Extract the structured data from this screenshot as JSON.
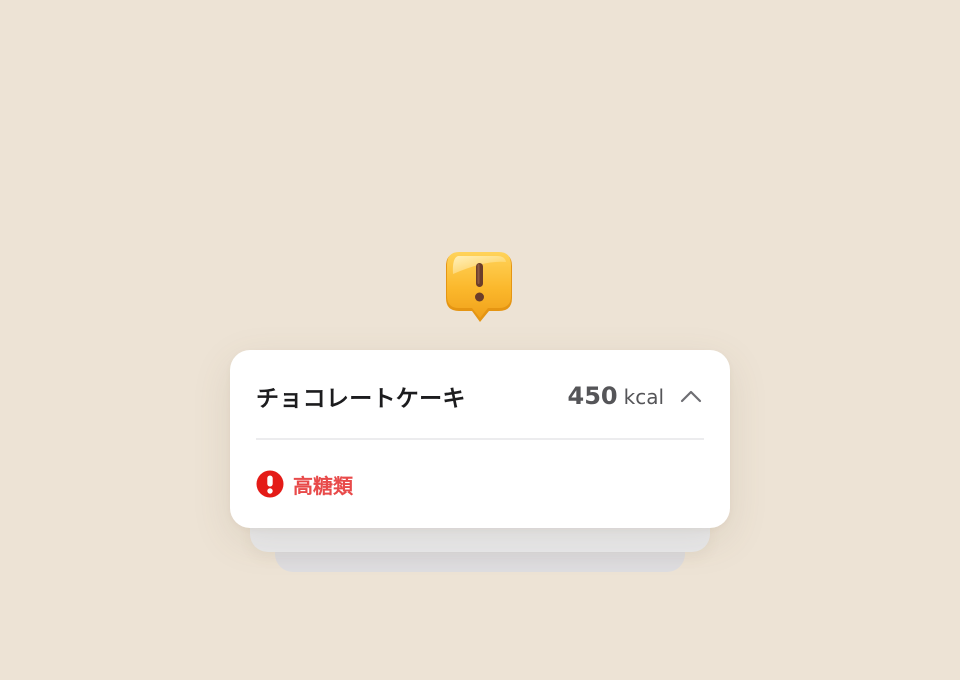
{
  "card": {
    "food_name": "チョコレートケーキ",
    "calorie_value": "450",
    "calorie_unit": "kcal",
    "expanded": true,
    "warnings": [
      {
        "label": "高糖類",
        "icon": "exclamation-circle-icon"
      }
    ]
  },
  "icons": {
    "badge": "alert-speech-bubble-icon",
    "toggle": "chevron-up-icon"
  },
  "colors": {
    "background": "#ede3d5",
    "warning": "#e84a4a",
    "badge": "#f7b52a"
  }
}
